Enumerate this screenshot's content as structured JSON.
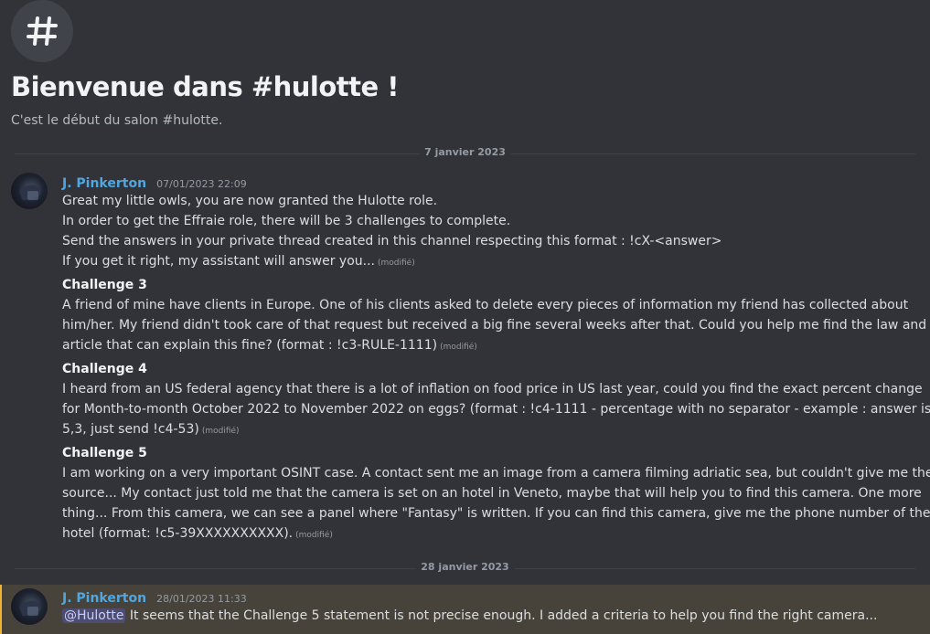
{
  "channel": {
    "welcome_title": "Bienvenue dans #hulotte !",
    "welcome_subtitle": "C'est le début du salon #hulotte."
  },
  "dividers": [
    "7 janvier 2023",
    "28 janvier 2023"
  ],
  "messages": [
    {
      "author": "J. Pinkerton",
      "timestamp": "07/01/2023 22:09",
      "intro": [
        "Great my little owls, you are now granted the Hulotte role.",
        "In order to get the Effraie role, there will be 3 challenges to complete.",
        "Send the answers in your private thread created in this channel respecting this format : !cX-<answer>",
        "If you get it right, my assistant will answer you..."
      ],
      "edited_label": "(modifié)",
      "challenges": [
        {
          "title": "Challenge 3",
          "lines": [
            "A friend of mine have clients in Europe. One of his clients asked to delete every pieces of information my friend has collected about",
            "him/her. My friend didn't took care of that request but received a big fine several weeks after that. Could you help me find the law and",
            "article that can explain this fine? (format : !c3-RULE-1111)"
          ]
        },
        {
          "title": "Challenge 4",
          "lines": [
            "I heard from an US federal agency that there is a lot of inflation on food price in US last year, could you find the exact percent change",
            "for Month-to-month October 2022 to November 2022 on eggs? (format : !c4-1111 - percentage with no separator - example : answer is",
            "5,3, just send !c4-53)"
          ]
        },
        {
          "title": "Challenge 5",
          "lines": [
            "I am working on a very important OSINT case. A contact sent me an image from a camera filming adriatic sea, but couldn't give me the",
            "source... My contact just told me that the camera is set on an hotel in Veneto, maybe that will help you to find this camera. One more",
            "thing... From this camera, we can see a panel where \"Fantasy\" is written. If you can find this camera, give me the phone number of the",
            "hotel (format: !c5-39XXXXXXXXXX)."
          ]
        }
      ]
    },
    {
      "author": "J. Pinkerton",
      "timestamp": "28/01/2023 11:33",
      "mention": "@Hulotte",
      "text": "It seems that the Challenge 5 statement is not precise enough. I added a criteria to help you find the right camera..."
    }
  ],
  "colors": {
    "background": "#313338",
    "author": "#4fa6e0",
    "mention_highlight": "#48433a",
    "mention_bar": "#f0b232"
  },
  "icons": {
    "channel_icon": "hash-icon",
    "avatar": "owl-avatar"
  }
}
